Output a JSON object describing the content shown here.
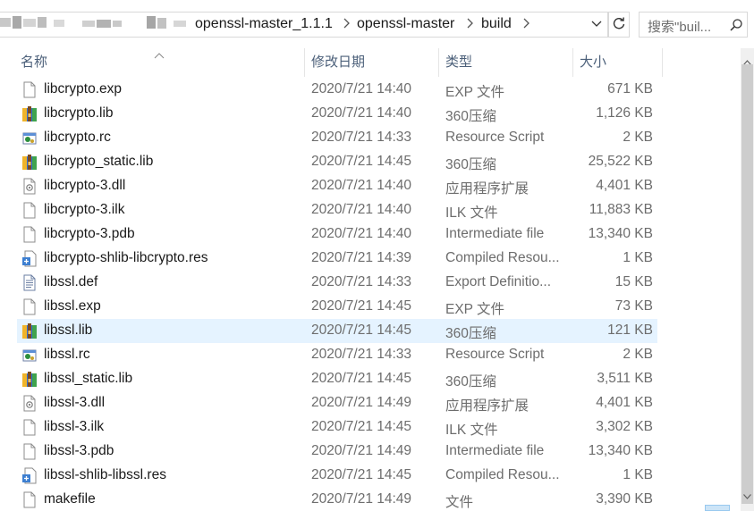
{
  "breadcrumb": {
    "items": [
      "openssl-master_1.1.1",
      "openssl-master",
      "build"
    ]
  },
  "search": {
    "placeholder": "搜索\"buil..."
  },
  "columns": {
    "name": "名称",
    "date": "修改日期",
    "type": "类型",
    "size": "大小"
  },
  "files": [
    {
      "name": "libcrypto.exp",
      "date": "2020/7/21 14:40",
      "type": "EXP 文件",
      "size": "671 KB",
      "icon": "generic-file-icon"
    },
    {
      "name": "libcrypto.lib",
      "date": "2020/7/21 14:40",
      "type": "360压缩",
      "size": "1,126 KB",
      "icon": "archive-360-icon"
    },
    {
      "name": "libcrypto.rc",
      "date": "2020/7/21 14:33",
      "type": "Resource Script",
      "size": "2 KB",
      "icon": "resource-script-icon"
    },
    {
      "name": "libcrypto_static.lib",
      "date": "2020/7/21 14:45",
      "type": "360压缩",
      "size": "25,522 KB",
      "icon": "archive-360-icon"
    },
    {
      "name": "libcrypto-3.dll",
      "date": "2020/7/21 14:40",
      "type": "应用程序扩展",
      "size": "4,401 KB",
      "icon": "dll-icon"
    },
    {
      "name": "libcrypto-3.ilk",
      "date": "2020/7/21 14:40",
      "type": "ILK 文件",
      "size": "11,883 KB",
      "icon": "generic-file-icon"
    },
    {
      "name": "libcrypto-3.pdb",
      "date": "2020/7/21 14:40",
      "type": "Intermediate file",
      "size": "13,340 KB",
      "icon": "generic-file-icon"
    },
    {
      "name": "libcrypto-shlib-libcrypto.res",
      "date": "2020/7/21 14:39",
      "type": "Compiled Resou...",
      "size": "1 KB",
      "icon": "compiled-resource-icon"
    },
    {
      "name": "libssl.def",
      "date": "2020/7/21 14:33",
      "type": "Export Definitio...",
      "size": "15 KB",
      "icon": "text-file-icon"
    },
    {
      "name": "libssl.exp",
      "date": "2020/7/21 14:45",
      "type": "EXP 文件",
      "size": "73 KB",
      "icon": "generic-file-icon"
    },
    {
      "name": "libssl.lib",
      "date": "2020/7/21 14:45",
      "type": "360压缩",
      "size": "121 KB",
      "icon": "archive-360-icon",
      "selected": true
    },
    {
      "name": "libssl.rc",
      "date": "2020/7/21 14:33",
      "type": "Resource Script",
      "size": "2 KB",
      "icon": "resource-script-icon"
    },
    {
      "name": "libssl_static.lib",
      "date": "2020/7/21 14:45",
      "type": "360压缩",
      "size": "3,511 KB",
      "icon": "archive-360-icon"
    },
    {
      "name": "libssl-3.dll",
      "date": "2020/7/21 14:49",
      "type": "应用程序扩展",
      "size": "4,401 KB",
      "icon": "dll-icon"
    },
    {
      "name": "libssl-3.ilk",
      "date": "2020/7/21 14:45",
      "type": "ILK 文件",
      "size": "3,302 KB",
      "icon": "generic-file-icon"
    },
    {
      "name": "libssl-3.pdb",
      "date": "2020/7/21 14:49",
      "type": "Intermediate file",
      "size": "13,340 KB",
      "icon": "generic-file-icon"
    },
    {
      "name": "libssl-shlib-libssl.res",
      "date": "2020/7/21 14:45",
      "type": "Compiled Resou...",
      "size": "1 KB",
      "icon": "compiled-resource-icon"
    },
    {
      "name": "makefile",
      "date": "2020/7/21 14:49",
      "type": "文件",
      "size": "3,390 KB",
      "icon": "generic-file-icon"
    }
  ]
}
